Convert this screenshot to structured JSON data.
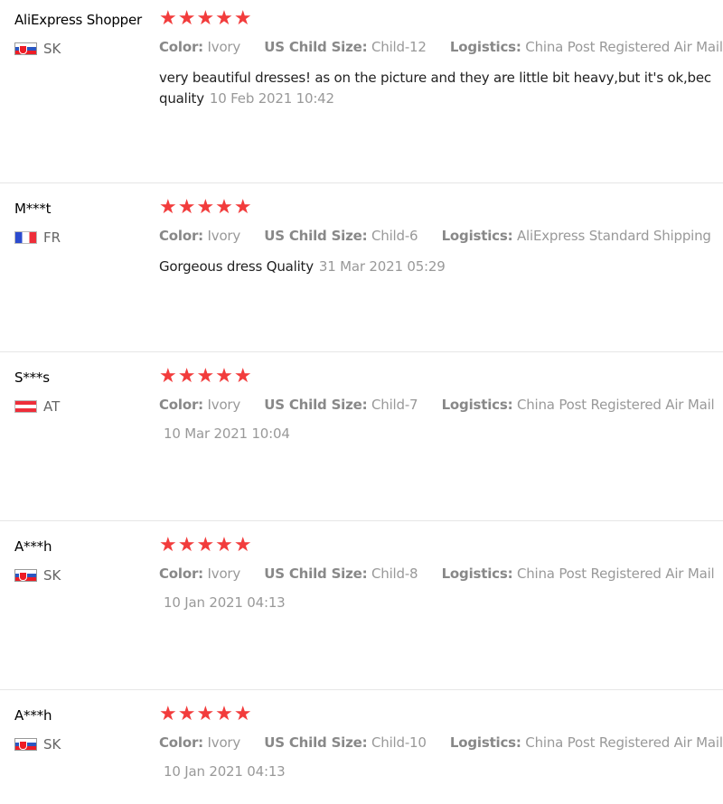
{
  "reviews": [
    {
      "user": "AliExpress Shopper",
      "country": "SK",
      "flag": "sk",
      "stars": "★★★★★",
      "color_label": "Color:",
      "color_value": "Ivory",
      "size_label": "US Child Size:",
      "size_value": "Child-12",
      "logistics_label": "Logistics:",
      "logistics_value": "China Post Registered Air Mail",
      "text_line1": "very beautiful dresses! as on the picture and they are little bit heavy,but it's ok,bec",
      "text_line2": "quality",
      "date": "10 Feb 2021 10:42"
    },
    {
      "user": "M***t",
      "country": "FR",
      "flag": "fr",
      "stars": "★★★★★",
      "color_label": "Color:",
      "color_value": "Ivory",
      "size_label": "US Child Size:",
      "size_value": "Child-6",
      "logistics_label": "Logistics:",
      "logistics_value": "AliExpress Standard Shipping",
      "text_line1": "Gorgeous dress Quality",
      "date": "31 Mar 2021 05:29"
    },
    {
      "user": "S***s",
      "country": "AT",
      "flag": "at",
      "stars": "★★★★★",
      "color_label": "Color:",
      "color_value": "Ivory",
      "size_label": "US Child Size:",
      "size_value": "Child-7",
      "logistics_label": "Logistics:",
      "logistics_value": "China Post Registered Air Mail",
      "date": "10 Mar 2021 10:04"
    },
    {
      "user": "A***h",
      "country": "SK",
      "flag": "sk",
      "stars": "★★★★★",
      "color_label": "Color:",
      "color_value": "Ivory",
      "size_label": "US Child Size:",
      "size_value": "Child-8",
      "logistics_label": "Logistics:",
      "logistics_value": "China Post Registered Air Mail",
      "date": "10 Jan 2021 04:13"
    },
    {
      "user": "A***h",
      "country": "SK",
      "flag": "sk",
      "stars": "★★★★★",
      "color_label": "Color:",
      "color_value": "Ivory",
      "size_label": "US Child Size:",
      "size_value": "Child-10",
      "logistics_label": "Logistics:",
      "logistics_value": "China Post Registered Air Mail",
      "date": "10 Jan 2021 04:13"
    }
  ],
  "colors": {
    "star": "#f23c3c",
    "label": "#888888",
    "value": "#999999",
    "text": "#222222",
    "divider": "#e6e6e6"
  }
}
